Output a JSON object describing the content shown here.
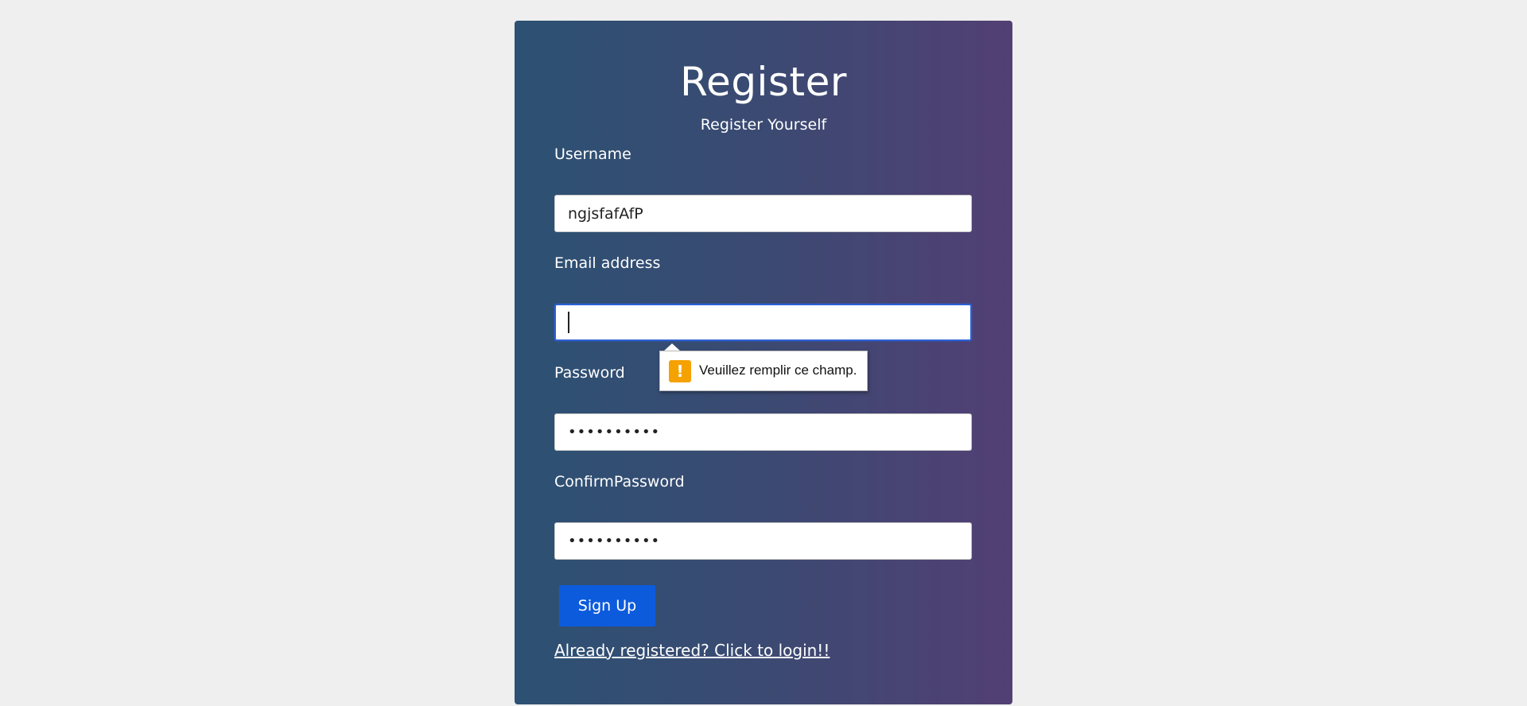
{
  "form": {
    "title": "Register",
    "subtitle": "Register Yourself",
    "username_label": "Username",
    "username_value": "ngjsfafAfP",
    "email_label": "Email address",
    "email_value": "",
    "password_label": "Password",
    "password_value": "••••••••••",
    "confirm_label": "ConfirmPassword",
    "confirm_value": "••••••••••",
    "submit_label": "Sign Up",
    "login_link": "Already registered? Click to login!!"
  },
  "validation": {
    "icon": "warning-icon",
    "message": "Veuillez remplir ce champ."
  },
  "colors": {
    "page_background": "#efefef",
    "card_gradient_start": "#2c5173",
    "card_gradient_end": "#523f74",
    "button": "#0d5bdd",
    "focus_border": "#2c61d6",
    "warning": "#f5a200"
  }
}
